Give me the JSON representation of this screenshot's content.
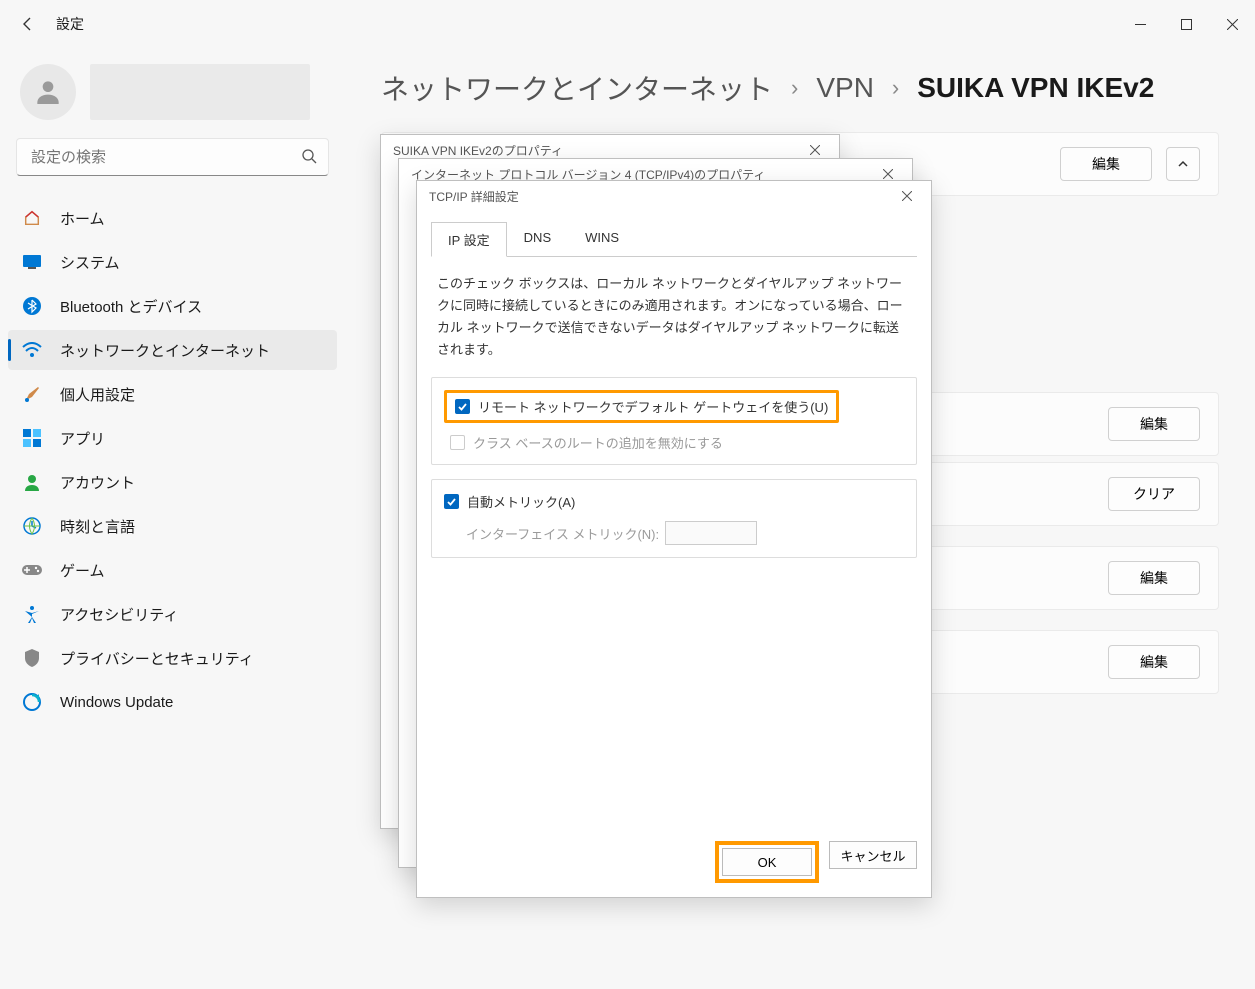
{
  "titlebar": {
    "app_title": "設定"
  },
  "search": {
    "placeholder": "設定の検索"
  },
  "nav": {
    "home": "ホーム",
    "system": "システム",
    "bluetooth": "Bluetooth とデバイス",
    "network": "ネットワークとインターネット",
    "personal": "個人用設定",
    "apps": "アプリ",
    "accounts": "アカウント",
    "time": "時刻と言語",
    "gaming": "ゲーム",
    "accessibility": "アクセシビリティ",
    "privacy": "プライバシーとセキュリティ",
    "update": "Windows Update"
  },
  "crumbs": {
    "root": "ネットワークとインターネット",
    "mid": "VPN",
    "current": "SUIKA VPN IKEv2"
  },
  "buttons": {
    "edit": "編集",
    "clear": "クリア",
    "ok": "OK",
    "cancel": "キャンセル"
  },
  "dlg1": {
    "title": "SUIKA VPN IKEv2のプロパティ"
  },
  "dlg2": {
    "title": "インターネット プロトコル バージョン 4 (TCP/IPv4)のプロパティ"
  },
  "dlg3": {
    "title": "TCP/IP 詳細設定",
    "tabs": {
      "ip": "IP 設定",
      "dns": "DNS",
      "wins": "WINS"
    },
    "desc": "このチェック ボックスは、ローカル ネットワークとダイヤルアップ ネットワークに同時に接続しているときにのみ適用されます。オンになっている場合、ローカル ネットワークで送信できないデータはダイヤルアップ ネットワークに転送されます。",
    "chk_gateway": "リモート ネットワークでデフォルト ゲートウェイを使う(U)",
    "chk_classroute": "クラス ベースのルートの追加を無効にする",
    "chk_autometric": "自動メトリック(A)",
    "lbl_ifmetric": "インターフェイス メトリック(N):"
  }
}
